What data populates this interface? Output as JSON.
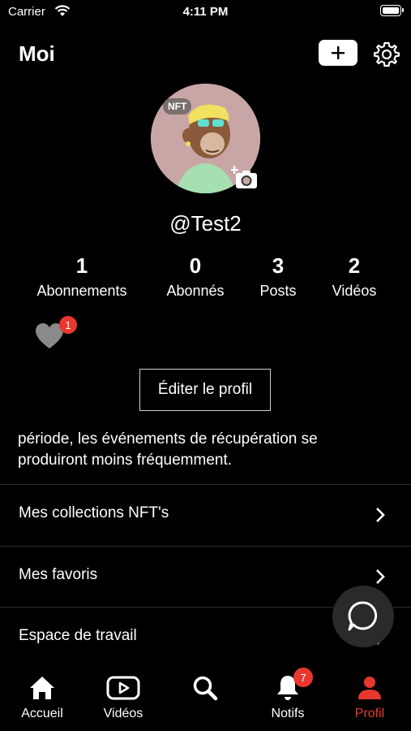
{
  "status_bar": {
    "carrier": "Carrier",
    "time": "4:11 PM"
  },
  "header": {
    "title": "Moi"
  },
  "profile": {
    "avatar_badge": "NFT",
    "username": "@Test2",
    "stats": [
      {
        "count": "1",
        "label": "Abonnements"
      },
      {
        "count": "0",
        "label": "Abonnés"
      },
      {
        "count": "3",
        "label": "Posts"
      },
      {
        "count": "2",
        "label": "Vidéos"
      }
    ],
    "likes_badge": "1",
    "edit_label": "Éditer le profil",
    "bio_line1": "période, les événements de récupération se",
    "bio_line2": "produiront moins fréquemment."
  },
  "menu": [
    {
      "label": "Mes collections NFT's"
    },
    {
      "label": "Mes favoris"
    },
    {
      "label": "Espace de travail"
    }
  ],
  "tabs": [
    {
      "label": "Accueil",
      "icon": "home-icon"
    },
    {
      "label": "Vidéos",
      "icon": "video-icon"
    },
    {
      "label": "",
      "icon": "search-icon"
    },
    {
      "label": "Notifs",
      "icon": "bell-icon",
      "badge": "7"
    },
    {
      "label": "Profil",
      "icon": "person-icon",
      "active": true
    }
  ],
  "colors": {
    "accent": "#e8372e",
    "background": "#000000",
    "avatar_bg": "#c9a6a6"
  }
}
